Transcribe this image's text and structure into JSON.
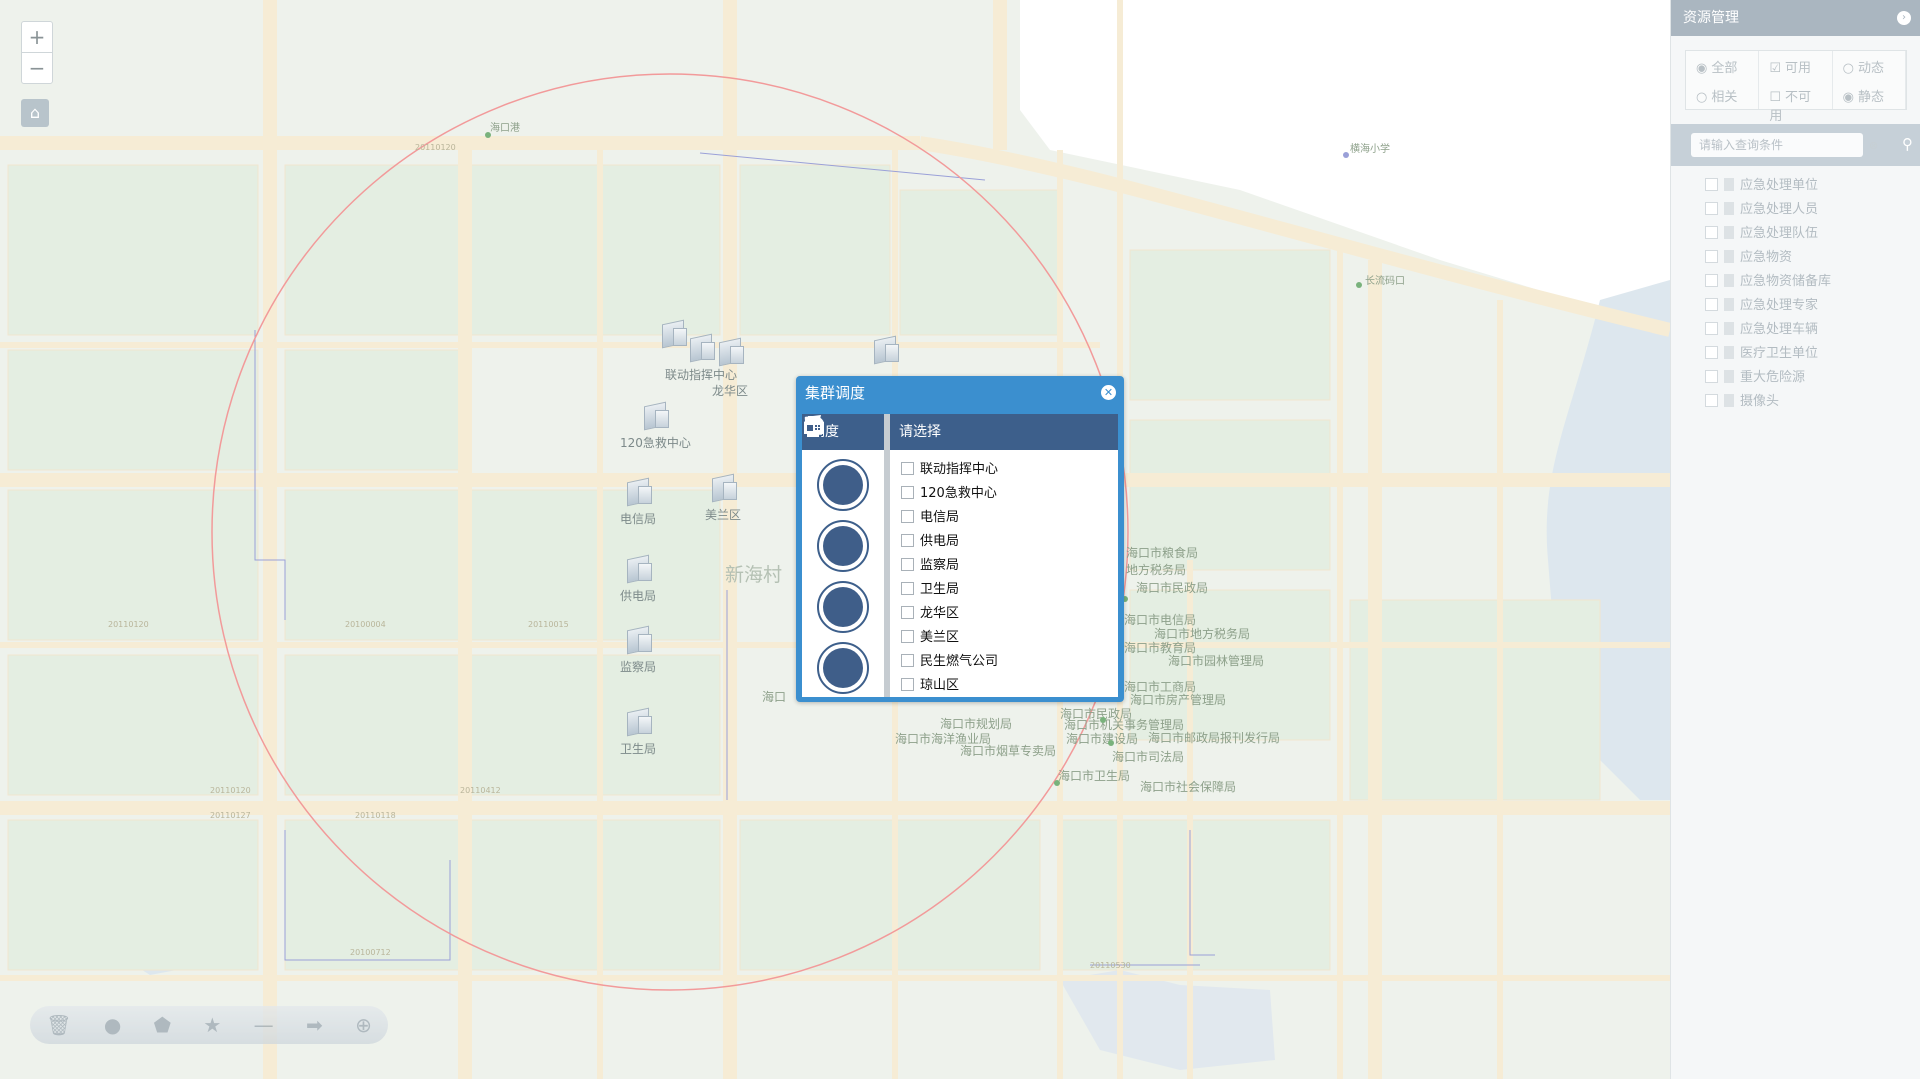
{
  "map": {
    "zoom_in": "+",
    "zoom_out": "−",
    "pois": [
      "联动指挥中心",
      "龙华区",
      "120急救中心",
      "电信局",
      "美兰区",
      "供电局",
      "监察局",
      "卫生局"
    ],
    "area_labels": [
      "新海村",
      "海口"
    ],
    "gov_labels": [
      "海口市粮食局",
      "地方税务局",
      "海口市民政局",
      "海口市电信局",
      "海口市地方税务局",
      "海口市教育局",
      "海口市园林管理局",
      "海口市工商局",
      "海口市房产管理局",
      "海口市民政局",
      "海口市规划局",
      "海口市机关事务管理局",
      "海口市海洋渔业局",
      "海口市建设局",
      "海口市邮政局报刊发行局",
      "海口市烟草专卖局",
      "海口市司法局",
      "海口市卫生局",
      "海口市社会保障局"
    ],
    "other_labels": [
      "海口港",
      "横海小学",
      "长流码口"
    ],
    "road_codes": [
      "20110120",
      "20100004",
      "20110015",
      "20110120",
      "20110118",
      "20110127",
      "20110412",
      "20100712",
      "20110120",
      "20110530"
    ]
  },
  "toolbar": {
    "icons": [
      "trash-icon",
      "sphere-icon",
      "polygon-icon",
      "star-icon",
      "line-icon",
      "arrow-icon",
      "plus-circle-icon"
    ]
  },
  "panel": {
    "title": "资源管理",
    "filters": [
      {
        "label": "全部",
        "type": "radio",
        "checked": true
      },
      {
        "label": "可用",
        "type": "checkbox",
        "checked": true
      },
      {
        "label": "动态",
        "type": "radio",
        "checked": false
      },
      {
        "label": "相关",
        "type": "radio",
        "checked": false
      },
      {
        "label": "不可用",
        "type": "checkbox",
        "checked": false
      },
      {
        "label": "静态",
        "type": "radio",
        "checked": true
      }
    ],
    "search_placeholder": "请输入查询条件",
    "tree": [
      "应急处理单位",
      "应急处理人员",
      "应急处理队伍",
      "应急物资",
      "应急物资储备库",
      "应急处理专家",
      "应急处理车辆",
      "医疗卫生单位",
      "重大危险源",
      "摄像头"
    ]
  },
  "dialog": {
    "title": "集群调度",
    "left_header": "调度",
    "right_header": "请选择",
    "actions": [
      "phone-icon",
      "message-icon",
      "fax-document-icon",
      "fax-machine-icon"
    ],
    "options": [
      "联动指挥中心",
      "120急救中心",
      "电信局",
      "供电局",
      "监察局",
      "卫生局",
      "龙华区",
      "美兰区",
      "民生燃气公司",
      "琼山区"
    ]
  },
  "colors": {
    "dialog_blue": "#3b8fcf",
    "header_navy": "#3d5f8b",
    "radius_circle": "#f29a9a"
  }
}
